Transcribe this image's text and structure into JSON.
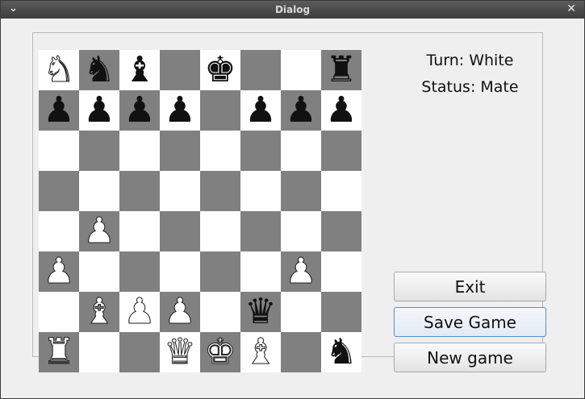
{
  "window": {
    "title": "Dialog"
  },
  "status": {
    "turn_label": "Turn: White",
    "status_label": "Status: Mate"
  },
  "buttons": {
    "exit": "Exit",
    "save": "Save Game",
    "new": "New game"
  },
  "icons": {
    "window_menu": "chevron-down-icon",
    "window_close": "close-icon"
  },
  "colors": {
    "light_square": "#ffffff",
    "dark_square": "#808080"
  },
  "board": [
    [
      "wN",
      "bN",
      "bB",
      "",
      "bK",
      "",
      "",
      "bR"
    ],
    [
      "bP",
      "bP",
      "bP",
      "bP",
      "",
      "bP",
      "bP",
      "bP"
    ],
    [
      "",
      "",
      "",
      "",
      "",
      "",
      "",
      ""
    ],
    [
      "",
      "",
      "",
      "",
      "",
      "",
      "",
      ""
    ],
    [
      "",
      "wP",
      "",
      "",
      "",
      "",
      "",
      ""
    ],
    [
      "wP",
      "",
      "",
      "",
      "",
      "",
      "wP",
      ""
    ],
    [
      "",
      "wB",
      "wP",
      "wP",
      "",
      "bQ",
      "",
      ""
    ],
    [
      "wR",
      "",
      "",
      "wQ",
      "wK",
      "wB",
      "",
      "bN"
    ]
  ]
}
